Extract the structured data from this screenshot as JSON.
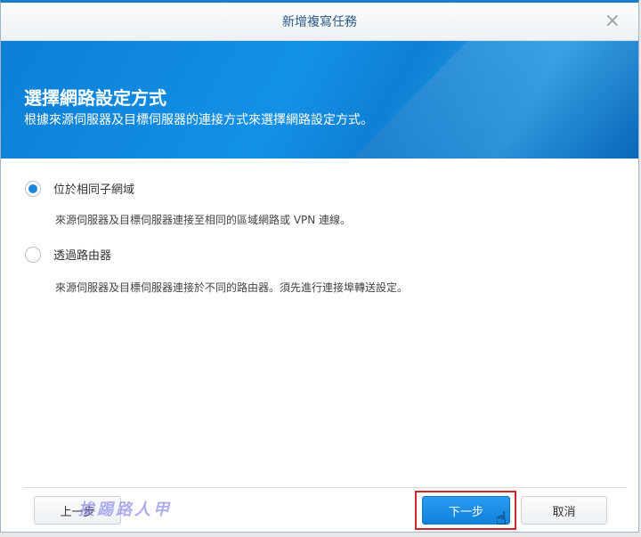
{
  "dialog": {
    "title": "新增複寫任務",
    "close_label": "×"
  },
  "banner": {
    "heading": "選擇網路設定方式",
    "subheading": "根據來源伺服器及目標伺服器的連接方式來選擇網路設定方式。"
  },
  "options": [
    {
      "label": "位於相同子網域",
      "description": "來源伺服器及目標伺服器連接至相同的區域網路或 VPN 連線。",
      "selected": true
    },
    {
      "label": "透過路由器",
      "description": "來源伺服器及目標伺服器連接於不同的路由器。須先進行連接埠轉送設定。",
      "selected": false
    }
  ],
  "footer": {
    "back_label": "上一步",
    "next_label": "下一步",
    "cancel_label": "取消"
  },
  "watermark": "挨踢路人甲",
  "colors": {
    "accent": "#1b86d9",
    "highlight": "#d0252b"
  }
}
